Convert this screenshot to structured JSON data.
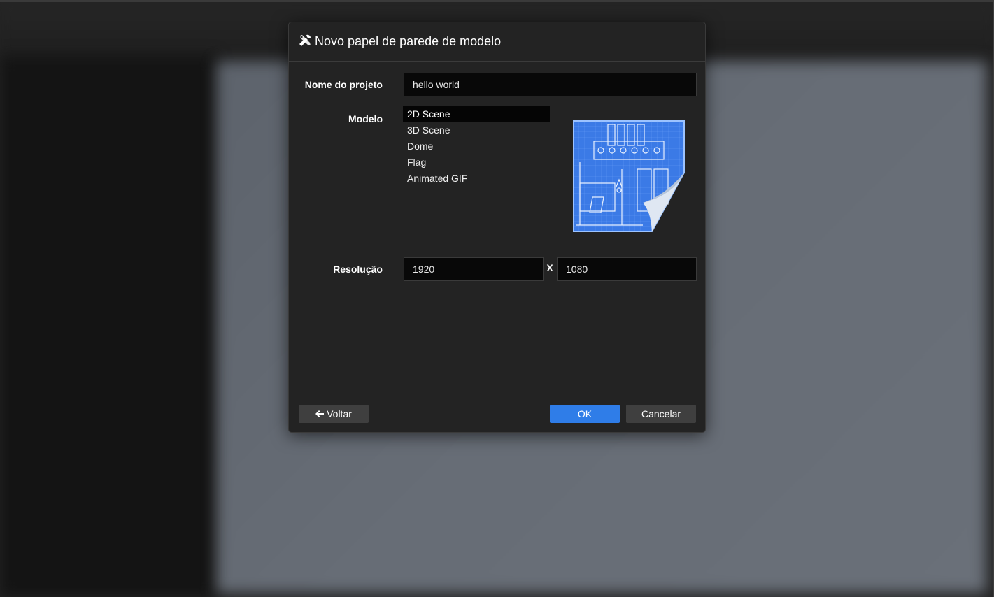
{
  "dialog": {
    "title": "Novo papel de parede de modelo",
    "icon": "tools-icon",
    "project_name_label": "Nome do projeto",
    "project_name_value": "hello world",
    "model_label": "Modelo",
    "models": [
      {
        "label": "2D Scene",
        "selected": true
      },
      {
        "label": "3D Scene",
        "selected": false
      },
      {
        "label": "Dome",
        "selected": false
      },
      {
        "label": "Flag",
        "selected": false
      },
      {
        "label": "Animated GIF",
        "selected": false
      }
    ],
    "preview_icon": "blueprint-preview-icon",
    "resolution_label": "Resolução",
    "resolution_width": "1920",
    "resolution_separator": "X",
    "resolution_height": "1080"
  },
  "footer": {
    "back_label": "Voltar",
    "back_icon": "arrow-left-icon",
    "ok_label": "OK",
    "cancel_label": "Cancelar"
  },
  "colors": {
    "accent": "#2f7de8",
    "dialog_bg": "#232323",
    "input_bg": "#080808"
  }
}
